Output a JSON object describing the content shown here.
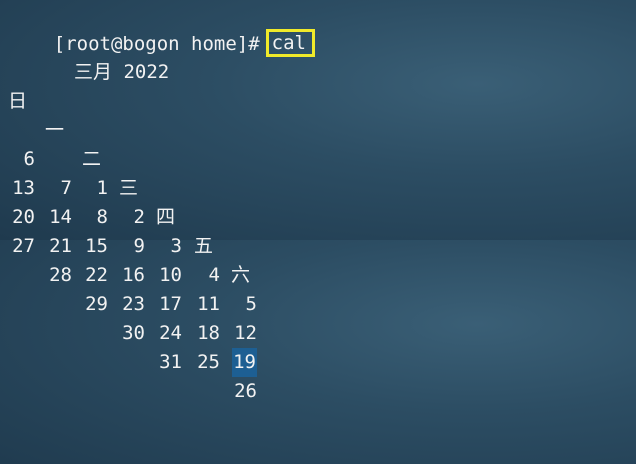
{
  "terminal": {
    "prompt": "[root@bogon home]#",
    "command": "cal"
  },
  "calendar": {
    "month_title": "三月 2022",
    "weekdays": [
      "日",
      "一",
      "二",
      "三",
      "四",
      "五",
      "六"
    ],
    "weeks": [
      [
        "",
        "",
        "1",
        "2",
        "3",
        "4",
        "5"
      ],
      [
        "6",
        "7",
        "8",
        "9",
        "10",
        "11",
        "12"
      ],
      [
        "13",
        "14",
        "15",
        "16",
        "17",
        "18",
        "19"
      ],
      [
        "20",
        "21",
        "22",
        "23",
        "24",
        "25",
        "26"
      ],
      [
        "27",
        "28",
        "29",
        "30",
        "31",
        "",
        ""
      ]
    ],
    "today": "19",
    "highlight_color": "#1d5f93"
  },
  "colors": {
    "command_box": "#f0ea2a",
    "text": "#f2f2f2"
  }
}
